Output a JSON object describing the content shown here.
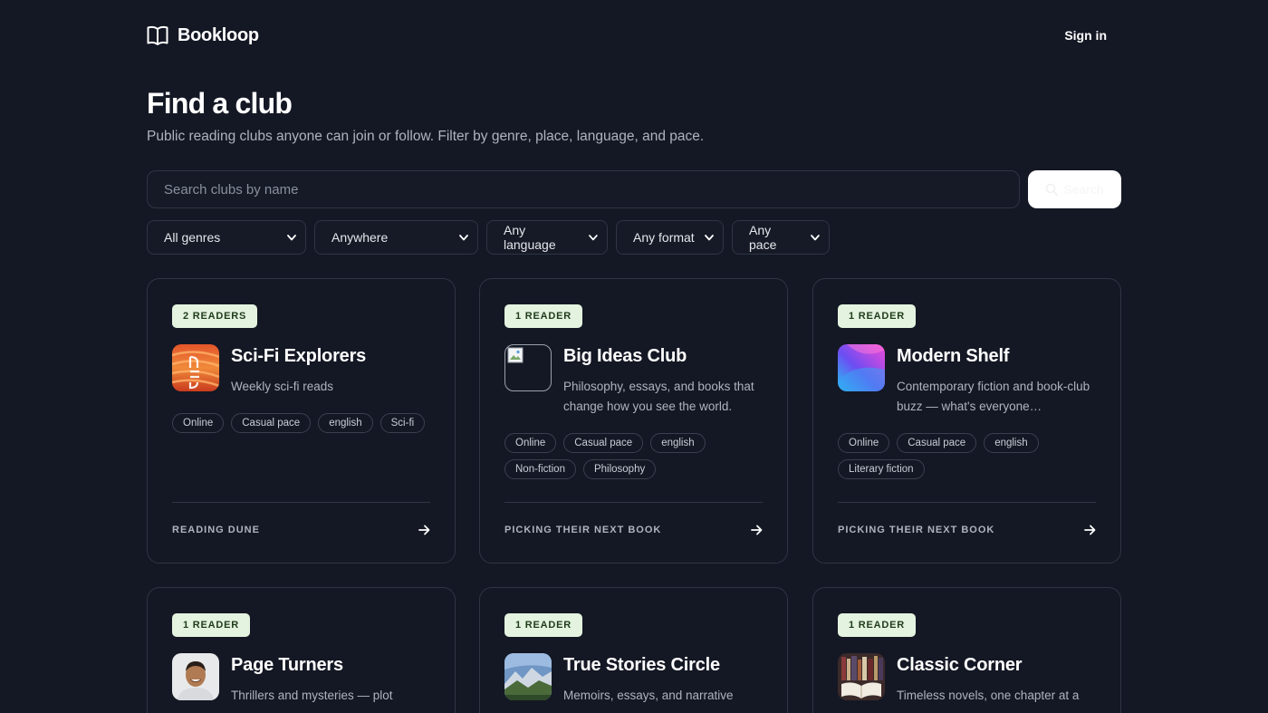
{
  "brand": {
    "name": "Bookloop",
    "icon": "open-book-icon"
  },
  "header": {
    "signin_label": "Sign in"
  },
  "page": {
    "title": "Find a club",
    "subtitle": "Public reading clubs anyone can join or follow. Filter by genre, place, language, and pace."
  },
  "search": {
    "placeholder": "Search clubs by name",
    "button_label": "Search"
  },
  "filters": [
    {
      "label": "All genres"
    },
    {
      "label": "Anywhere"
    },
    {
      "label": "Any language"
    },
    {
      "label": "Any format"
    },
    {
      "label": "Any pace"
    }
  ],
  "clubs": [
    {
      "badge": "2 READERS",
      "name": "Sci-Fi Explorers",
      "description": "Weekly sci-fi reads",
      "tags": [
        "Online",
        "Casual pace",
        "english",
        "Sci-fi"
      ],
      "status": "READING DUNE",
      "avatar": "book-cover-image"
    },
    {
      "badge": "1 READER",
      "name": "Big Ideas Club",
      "description": "Philosophy, essays, and books that change how you see the world.",
      "tags": [
        "Online",
        "Casual pace",
        "english",
        "Non-fiction",
        "Philosophy"
      ],
      "status": "PICKING THEIR NEXT BOOK",
      "avatar": "broken-image"
    },
    {
      "badge": "1 READER",
      "name": "Modern Shelf",
      "description": "Contemporary fiction and book-club buzz — what's everyone…",
      "tags": [
        "Online",
        "Casual pace",
        "english",
        "Literary fiction"
      ],
      "status": "PICKING THEIR NEXT BOOK",
      "avatar": "gradient-image"
    },
    {
      "badge": "1 READER",
      "name": "Page Turners",
      "description": "Thrillers and mysteries — plot",
      "tags": [],
      "status": "",
      "avatar": "person-photo"
    },
    {
      "badge": "1 READER",
      "name": "True Stories Circle",
      "description": "Memoirs, essays, and narrative",
      "tags": [],
      "status": "",
      "avatar": "landscape-photo"
    },
    {
      "badge": "1 READER",
      "name": "Classic Corner",
      "description": "Timeless novels, one chapter at a",
      "tags": [],
      "status": "",
      "avatar": "books-photo"
    }
  ],
  "colors": {
    "background": "#141824",
    "badge_bg": "#e4f3df",
    "badge_text": "#1f3b1b",
    "border": "#2f3545"
  }
}
